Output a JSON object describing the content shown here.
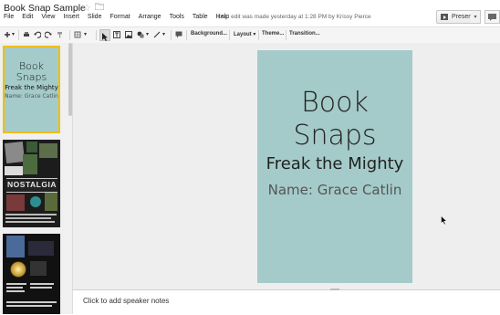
{
  "app": {
    "title": "Book Snap Sample",
    "last_edit": "Last edit was made yesterday at 1:28 PM by Krissy Pierce",
    "present_label": "Present"
  },
  "menu": [
    "File",
    "Edit",
    "View",
    "Insert",
    "Slide",
    "Format",
    "Arrange",
    "Tools",
    "Table",
    "Help"
  ],
  "toolbar": {
    "background_label": "Background...",
    "layout_label": "Layout",
    "theme_label": "Theme...",
    "transition_label": "Transition..."
  },
  "slide": {
    "title_line1": "Book",
    "title_line2": "Snaps",
    "subtitle": "Freak the Mighty",
    "name": "Name: Grace Catlin",
    "background": "#a4cbca"
  },
  "thumbnails": [
    {
      "title_line1": "Book",
      "title_line2": "Snaps",
      "subtitle": "Freak the Mighty",
      "name": "Name: Grace Catlin"
    }
  ],
  "thumb2_banner": "NOSTALGIA",
  "notes": {
    "placeholder": "Click to add speaker notes"
  },
  "colors": {
    "accent_selected": "#f0c000",
    "slide_bg": "#a4cbca"
  }
}
